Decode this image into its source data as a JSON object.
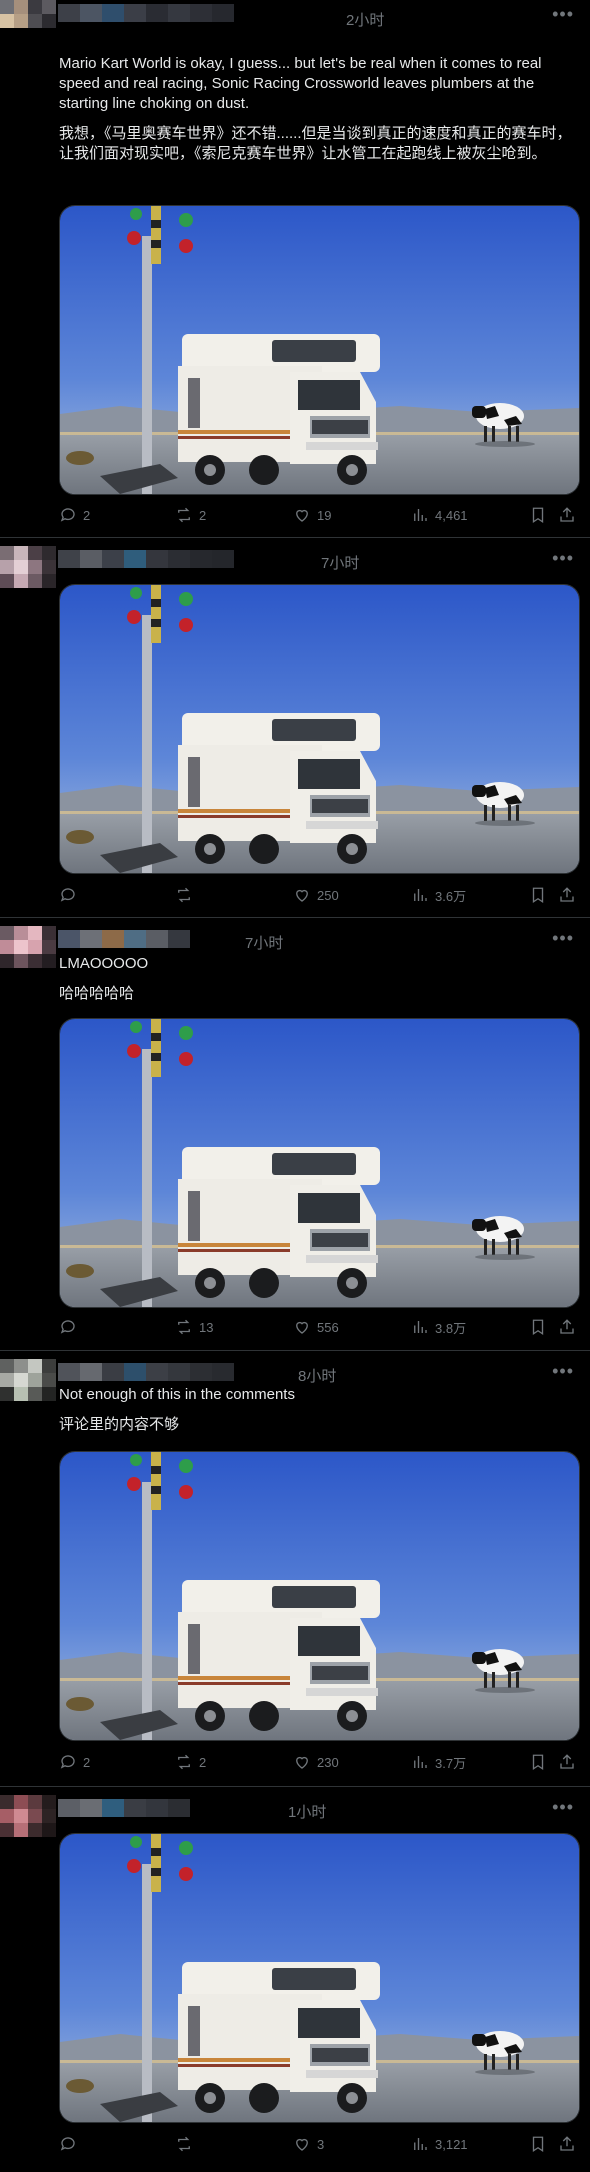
{
  "posts": [
    {
      "time": "2小时",
      "text_en": "Mario Kart World is okay, I guess... but let's be real when it comes to real speed and real racing, Sonic Racing Crossworld leaves plumbers at the starting line choking on dust.",
      "text_zh": "我想，《马里奥赛车世界》还不错......但是当谈到真正的速度和真正的赛车时，让我们面对现实吧，《索尼克赛车世界》让水管工在起跑线上被灰尘呛到。",
      "replies": "2",
      "reposts": "2",
      "likes": "19",
      "views": "4,461"
    },
    {
      "time": "7小时",
      "replies": "",
      "reposts": "",
      "likes": "250",
      "views": "3.6万"
    },
    {
      "time": "7小时",
      "text_en": "LMAOOOOO",
      "text_zh": "哈哈哈哈哈",
      "replies": "",
      "reposts": "13",
      "likes": "556",
      "views": "3.8万"
    },
    {
      "time": "8小时",
      "text_en": "Not enough of this in the comments",
      "text_zh": "评论里的内容不够",
      "replies": "2",
      "reposts": "2",
      "likes": "230",
      "views": "3.7万"
    },
    {
      "time": "1小时",
      "replies": "",
      "reposts": "",
      "likes": "3",
      "views": "3,121"
    }
  ],
  "more_glyph": "•••",
  "icons": [
    "reply-icon",
    "repost-icon",
    "like-icon",
    "views-icon",
    "bookmark-icon",
    "share-icon"
  ],
  "colors": {
    "background": "#000000",
    "text": "#e7e9ea",
    "secondary": "#71767b",
    "divider": "#2f3336"
  }
}
